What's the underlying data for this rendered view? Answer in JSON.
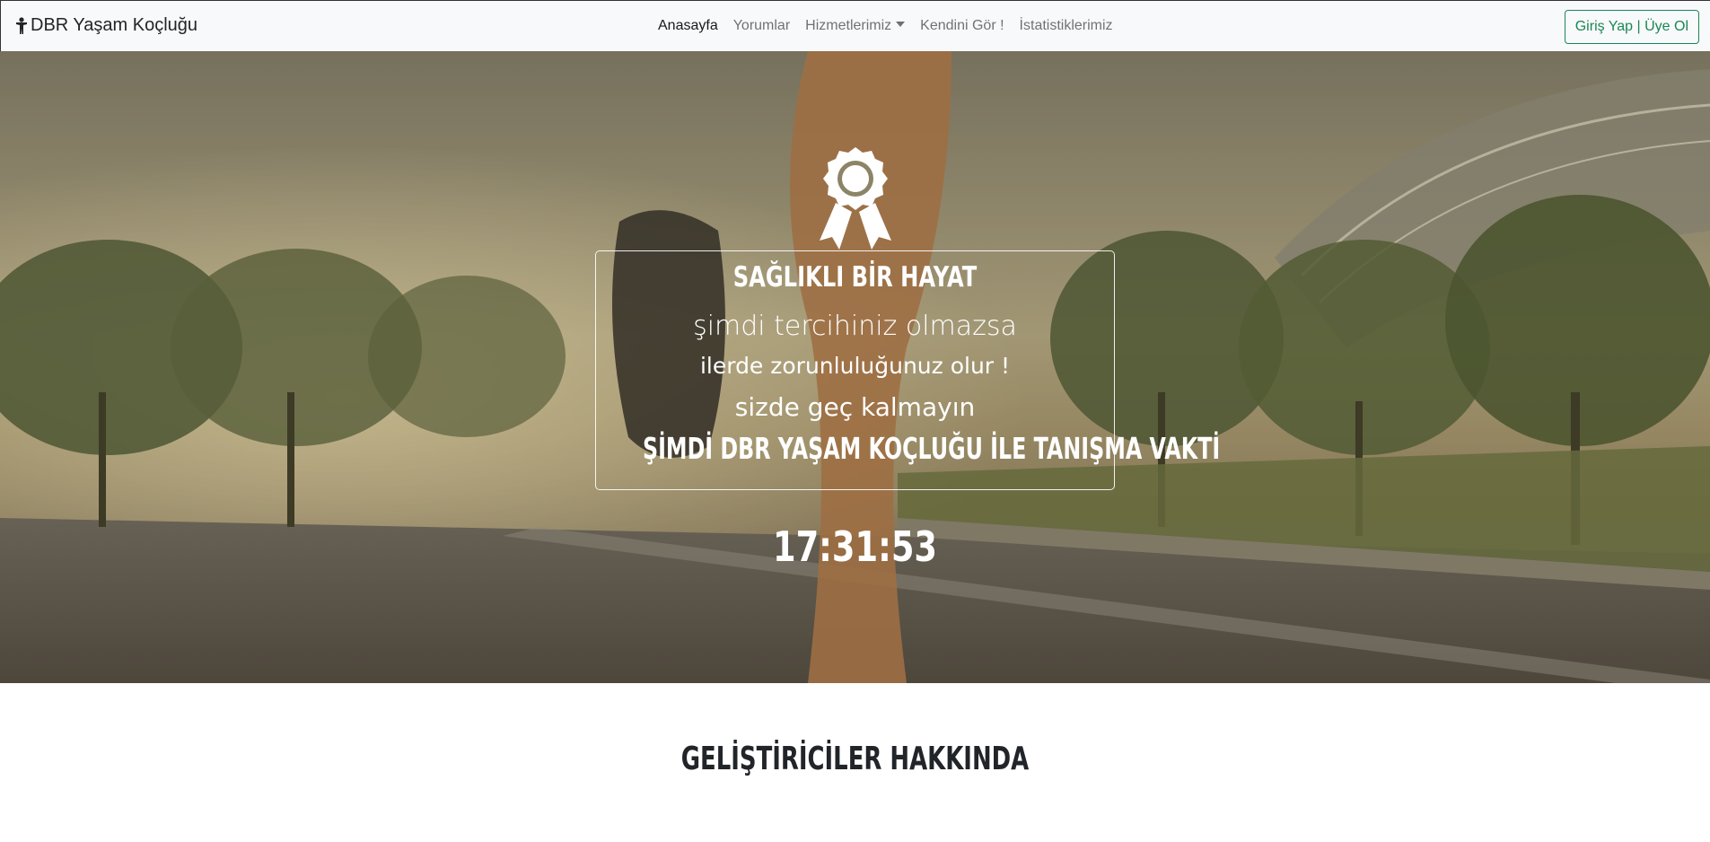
{
  "navbar": {
    "brand": "DBR Yaşam Koçluğu",
    "links": [
      {
        "label": "Anasayfa",
        "active": true
      },
      {
        "label": "Yorumlar",
        "active": false
      },
      {
        "label": "Hizmetlerimiz",
        "active": false,
        "dropdown": true
      },
      {
        "label": "Kendini Gör !",
        "active": false
      },
      {
        "label": "İstatistiklerimiz",
        "active": false
      }
    ],
    "login_label": "Giriş Yap | Üye Ol"
  },
  "hero": {
    "headline": "SAĞLIKLI BİR HAYAT",
    "line1": "şimdi tercihiniz olmazsa",
    "line2": "ilerde zorunluluğunuz olur !",
    "line3": "sizde geç kalmayın",
    "cta": "ŞİMDİ DBR YAŞAM KOÇLUĞU İLE TANIŞMA VAKTİ",
    "clock": "17:31:53"
  },
  "about": {
    "title": "GELİŞTİRİCİLER HAKKINDA"
  },
  "colors": {
    "accent": "#198754",
    "navbar_bg": "#f8f9fa"
  },
  "icons": {
    "brand": "person-icon",
    "award": "award-ribbon-icon"
  }
}
